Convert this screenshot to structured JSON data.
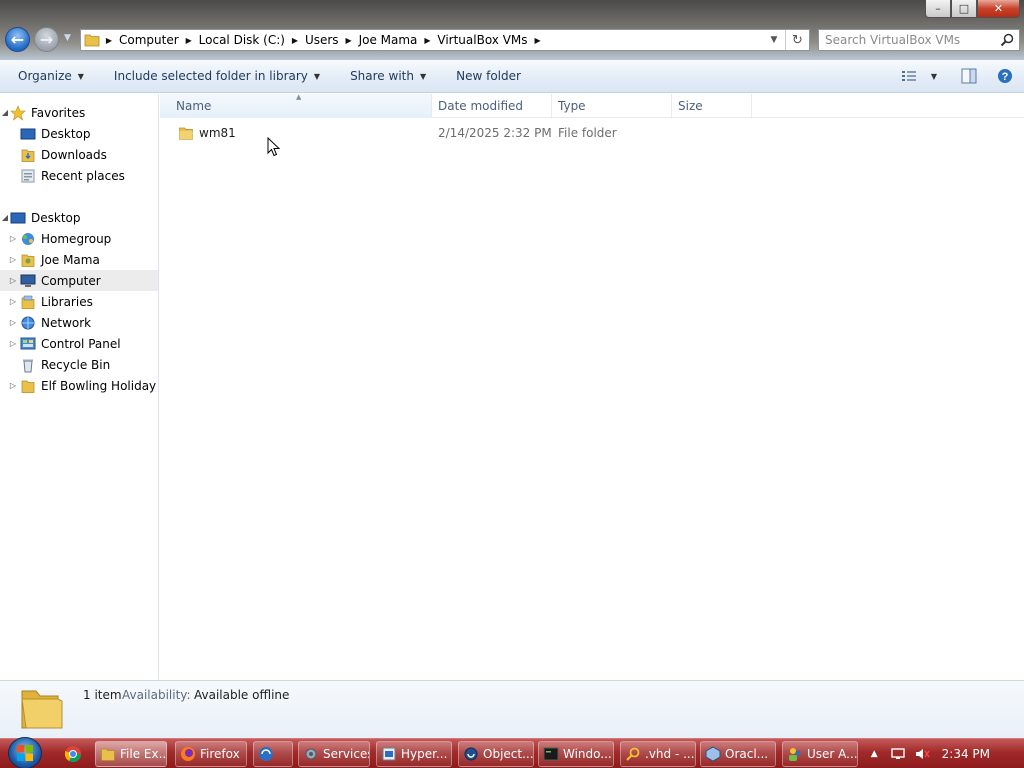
{
  "window": {
    "minimize_glyph": "–",
    "maximize_glyph": "□",
    "close_glyph": "✕"
  },
  "address": {
    "crumbs": [
      "Computer",
      "Local Disk (C:)",
      "Users",
      "Joe Mama",
      "VirtualBox VMs"
    ]
  },
  "search": {
    "placeholder": "Search VirtualBox VMs"
  },
  "toolbar": {
    "organize": "Organize",
    "include_library": "Include selected folder in library",
    "share_with": "Share with",
    "new_folder": "New folder"
  },
  "navpane": {
    "favorites": "Favorites",
    "favorites_items": [
      "Desktop",
      "Downloads",
      "Recent places"
    ],
    "desktop": "Desktop",
    "desktop_items": [
      "Homegroup",
      "Joe Mama",
      "Computer",
      "Libraries",
      "Network",
      "Control Panel",
      "Recycle Bin",
      "Elf Bowling Holiday"
    ],
    "selected": "Computer"
  },
  "columns": {
    "name": "Name",
    "date_modified": "Date modified",
    "type": "Type",
    "size": "Size"
  },
  "files": [
    {
      "name": "wm81",
      "date_modified": "2/14/2025 2:32 PM",
      "type": "File folder",
      "size": ""
    }
  ],
  "details": {
    "count": "1 item",
    "availability_label": "Availability:",
    "availability_value": "Available offline"
  },
  "taskbar": {
    "tasks": [
      "File Ex...",
      "Firefox",
      "Services",
      "Hyper...",
      "Object...",
      "Windo...",
      ".vhd - ...",
      "Oracl...",
      "User A..."
    ],
    "clock": "2:34 PM"
  },
  "colors": {
    "taskbar": "#a12a2a",
    "toolbar_text": "#1e395b",
    "column_header_text": "#4c607a",
    "folder_yellow": "#e8c04a"
  }
}
